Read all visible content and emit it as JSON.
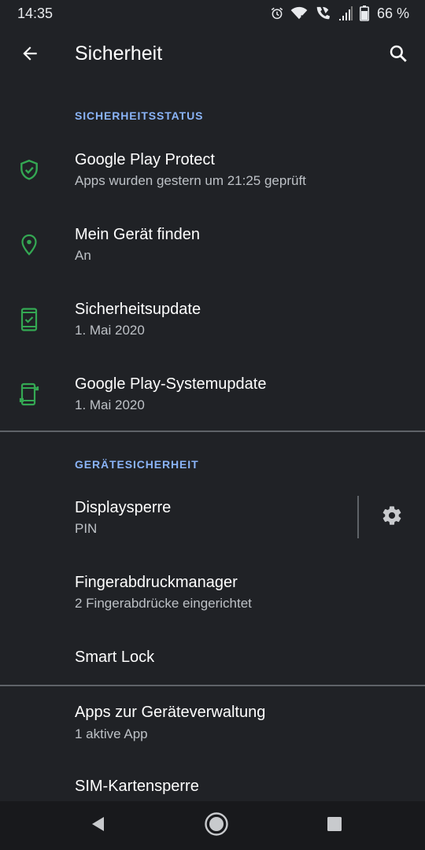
{
  "status_bar": {
    "time": "14:35",
    "battery_text": "66 %",
    "icons": [
      "alarm-icon",
      "wifi-icon",
      "wifi-calling-icon",
      "signal-icon",
      "battery-icon"
    ]
  },
  "app_bar": {
    "title": "Sicherheit",
    "back_icon": "arrow-back-icon",
    "search_icon": "search-icon"
  },
  "sections": [
    {
      "header": "SICHERHEITSSTATUS",
      "items": [
        {
          "title": "Google Play Protect",
          "subtitle": "Apps wurden gestern um 21:25 geprüft",
          "icon": "shield-check-icon"
        },
        {
          "title": "Mein Gerät finden",
          "subtitle": "An",
          "icon": "location-pin-icon"
        },
        {
          "title": "Sicherheitsupdate",
          "subtitle": "1. Mai 2020",
          "icon": "phone-check-icon"
        },
        {
          "title": "Google Play-Systemupdate",
          "subtitle": "1. Mai 2020",
          "icon": "phone-update-icon"
        }
      ]
    },
    {
      "header": "GERÄTESICHERHEIT",
      "items": [
        {
          "title": "Displaysperre",
          "subtitle": "PIN",
          "action_icon": "gear-icon"
        },
        {
          "title": "Fingerabdruckmanager",
          "subtitle": "2 Fingerabdrücke eingerichtet"
        },
        {
          "title": "Smart Lock"
        }
      ]
    },
    {
      "items": [
        {
          "title": "Apps zur Geräteverwaltung",
          "subtitle": "1 aktive App"
        },
        {
          "title": "SIM-Kartensperre"
        }
      ]
    }
  ],
  "nav_bar": {
    "icons": [
      "nav-back-icon",
      "nav-home-icon",
      "nav-recents-icon"
    ]
  },
  "colors": {
    "background": "#202226",
    "accent_green": "#34a853",
    "section_header": "#8ab4f8",
    "divider": "#5f6368"
  }
}
